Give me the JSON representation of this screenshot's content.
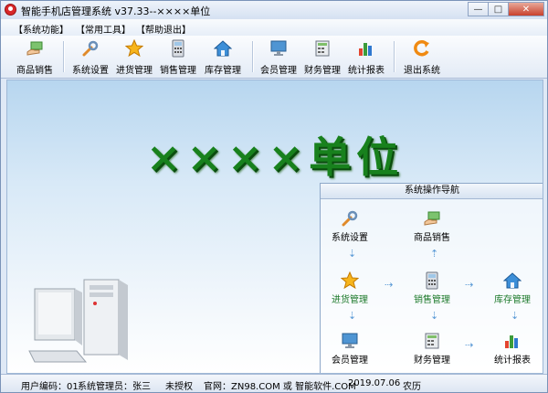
{
  "window": {
    "title": "智能手机店管理系统 v37.33--××××单位"
  },
  "menu": [
    "【系统功能】",
    "【常用工具】",
    "【帮助退出】"
  ],
  "toolbar": [
    {
      "label": "商品销售",
      "icon": "hand-cash-icon"
    },
    {
      "label": "系统设置",
      "icon": "wrench-icon"
    },
    {
      "label": "进货管理",
      "icon": "star-icon"
    },
    {
      "label": "销售管理",
      "icon": "calculator-icon"
    },
    {
      "label": "库存管理",
      "icon": "house-icon"
    },
    {
      "label": "会员管理",
      "icon": "monitor-icon"
    },
    {
      "label": "财务管理",
      "icon": "ledger-icon"
    },
    {
      "label": "统计报表",
      "icon": "bar-chart-icon"
    },
    {
      "label": "退出系统",
      "icon": "exit-icon"
    }
  ],
  "banner": "××××单位",
  "nav": {
    "title": "系统操作导航",
    "nodes": [
      "系统设置",
      "商品销售",
      "进货管理",
      "销售管理",
      "库存管理",
      "会员管理",
      "财务管理",
      "统计报表"
    ]
  },
  "status": {
    "user_code": "用户编码：01",
    "admin": "系统管理员：张三",
    "auth": "未授权",
    "site": "官网：ZN98.COM 或 智能软件.COM",
    "date": "2019.07.06",
    "lunar": "农历"
  },
  "colors": {
    "accent": "#18811d",
    "titlebar": "#d5e1f2",
    "close": "#c8402c"
  }
}
